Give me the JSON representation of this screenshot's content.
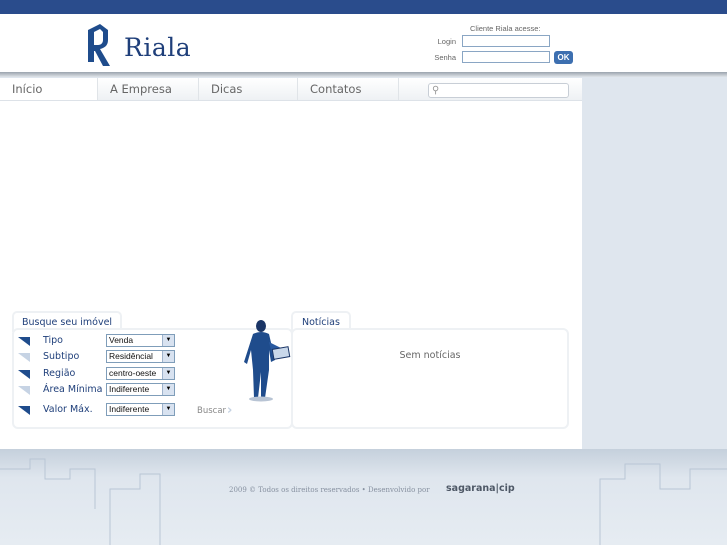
{
  "header": {
    "brand": "Riala",
    "login": {
      "title": "Cliente Riala acesse:",
      "login_label": "Login",
      "password_label": "Senha",
      "login_value": "",
      "password_value": "",
      "ok_label": "OK"
    }
  },
  "nav": {
    "items": [
      {
        "label": "Início"
      },
      {
        "label": "A Empresa"
      },
      {
        "label": "Dicas"
      },
      {
        "label": "Contatos"
      }
    ],
    "search_value": ""
  },
  "search_panel": {
    "title": "Busque seu imóvel",
    "fields": [
      {
        "label": "Tipo",
        "value": "Venda"
      },
      {
        "label": "Subtipo",
        "value": "Residêncial"
      },
      {
        "label": "Região",
        "value": "centro-oeste"
      },
      {
        "label": "Área Mínima",
        "value": "Indiferente"
      },
      {
        "label": "Valor Máx.",
        "value": "Indiferente"
      }
    ],
    "submit_label": "Buscar"
  },
  "news_panel": {
    "title": "Notícias",
    "empty_text": "Sem notícias"
  },
  "footer": {
    "copyright": "2009 © Todos os direitos reservados • Desenvolvido por",
    "developer": "sagarana|cip"
  },
  "colors": {
    "topbar": "#2a4c8c",
    "brand_blue": "#1f3f7a",
    "ok_button": "#3d6fb0"
  }
}
